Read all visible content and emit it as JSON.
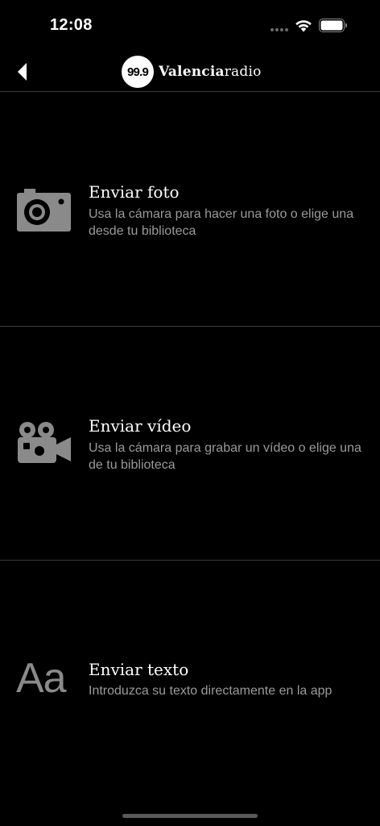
{
  "status_bar": {
    "time": "12:08"
  },
  "nav": {
    "logo_number": "99.9",
    "logo_bold": "Valencia",
    "logo_light": "radio"
  },
  "options": [
    {
      "icon": "camera-icon",
      "title": "Enviar foto",
      "description": "Usa la cámara para hacer una foto o elige una desde tu biblioteca"
    },
    {
      "icon": "video-camera-icon",
      "title": "Enviar vídeo",
      "description": "Usa la cámara para grabar un vídeo o elige una de tu biblioteca"
    },
    {
      "icon": "text-icon",
      "icon_glyph": "Aa",
      "title": "Enviar texto",
      "description": "Introduzca su texto directamente en la app"
    }
  ],
  "colors": {
    "background": "#000000",
    "icon": "#8a8a8a",
    "description": "#9a9a9a",
    "divider": "#3a3a3a"
  }
}
